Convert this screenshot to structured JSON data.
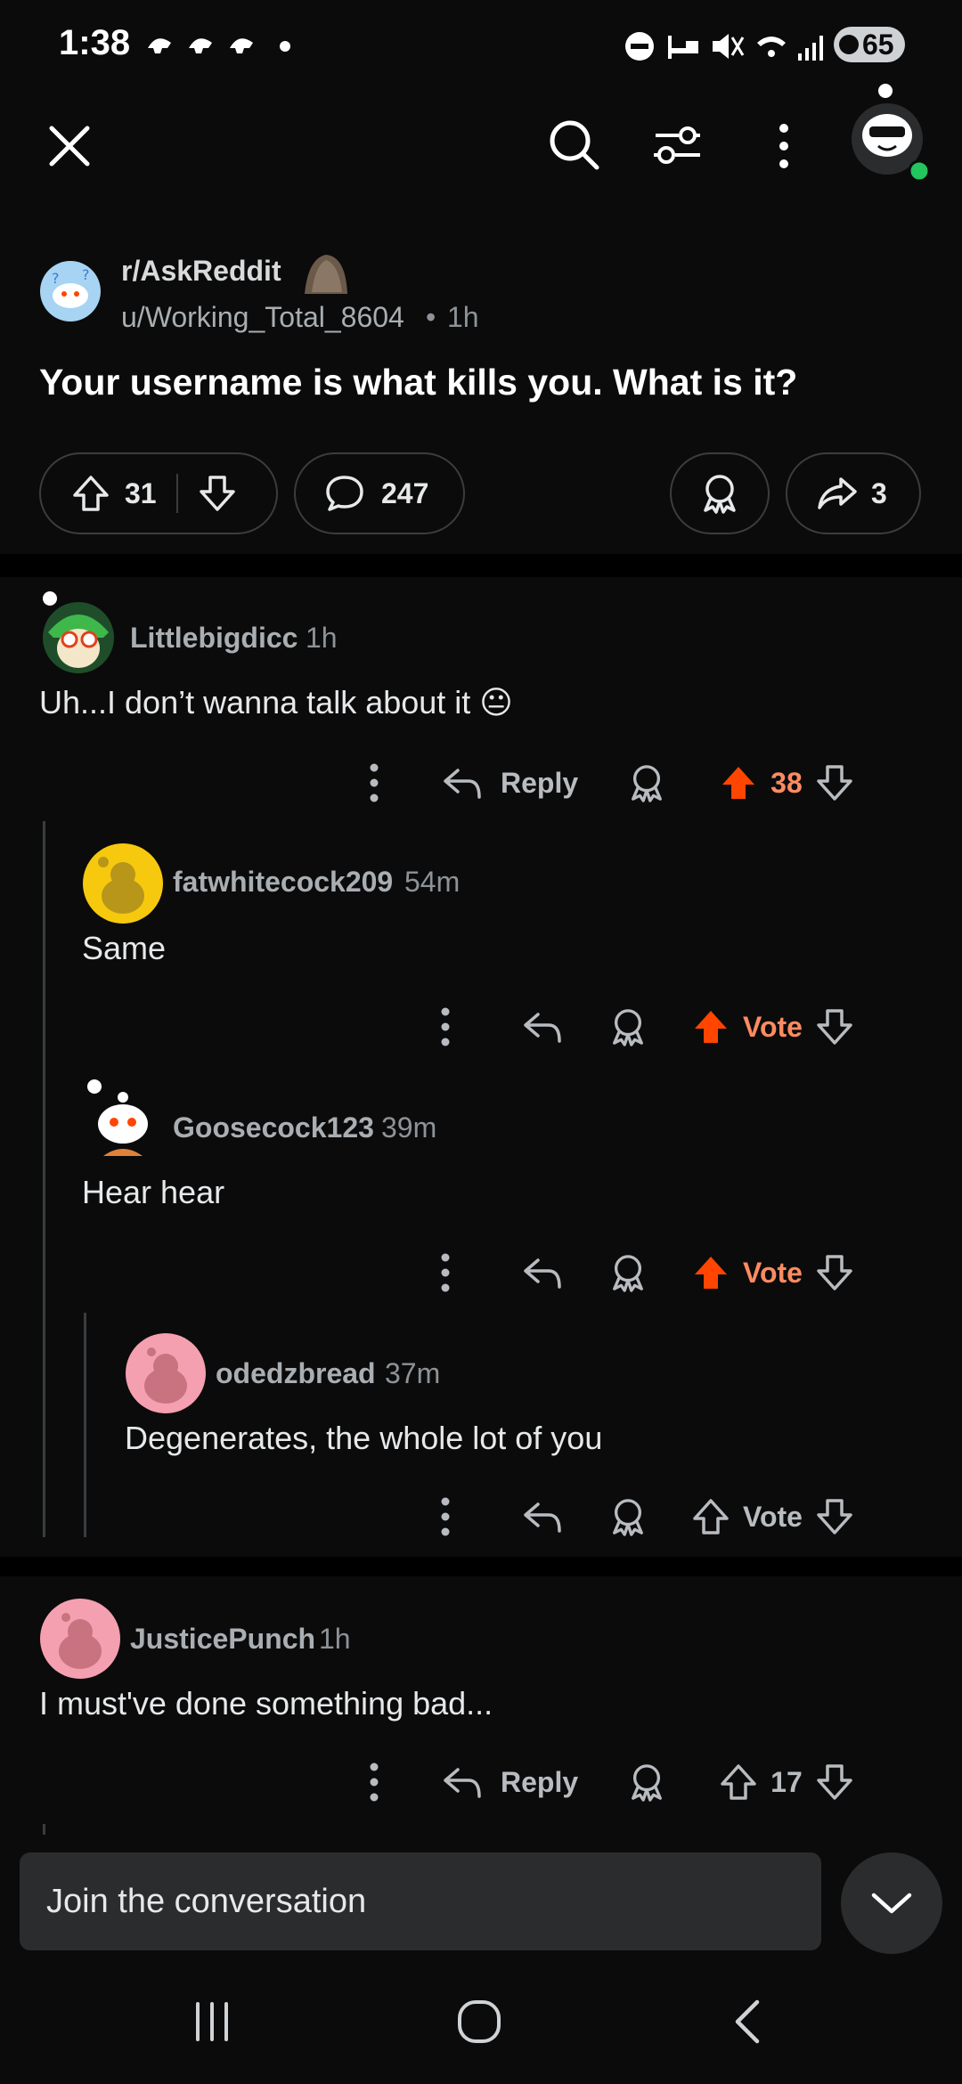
{
  "status_bar": {
    "time": "1:38",
    "battery": "65"
  },
  "post": {
    "subreddit": "r/AskReddit",
    "author": "u/Working_Total_8604",
    "age": "1h",
    "title": "Your username is what kills you. What is it?",
    "upvotes": "31",
    "comments": "247",
    "shares": "3"
  },
  "comments": [
    {
      "user": "Littlebigdicc",
      "age": "1h",
      "body": "Uh...I don’t wanna talk about it 😐",
      "reply_label": "Reply",
      "score": "38"
    },
    {
      "user": "fatwhitecock209",
      "age": "54m",
      "body": "Same",
      "score": "Vote"
    },
    {
      "user": "Goosecock123",
      "age": "39m",
      "body": "Hear hear",
      "score": "Vote"
    },
    {
      "user": "odedzbread",
      "age": "37m",
      "body": "Degenerates, the whole lot of you",
      "score": "Vote"
    },
    {
      "user": "JusticePunch",
      "age": "1h",
      "body": "I must've done something bad...",
      "reply_label": "Reply",
      "score": "17"
    }
  ],
  "composer": {
    "placeholder": "Join the conversation"
  },
  "colors": {
    "upvote_active": "#ff4500",
    "score_active": "#ff8b60",
    "background": "#0b0b0b",
    "pill_border": "#3a3d40"
  }
}
